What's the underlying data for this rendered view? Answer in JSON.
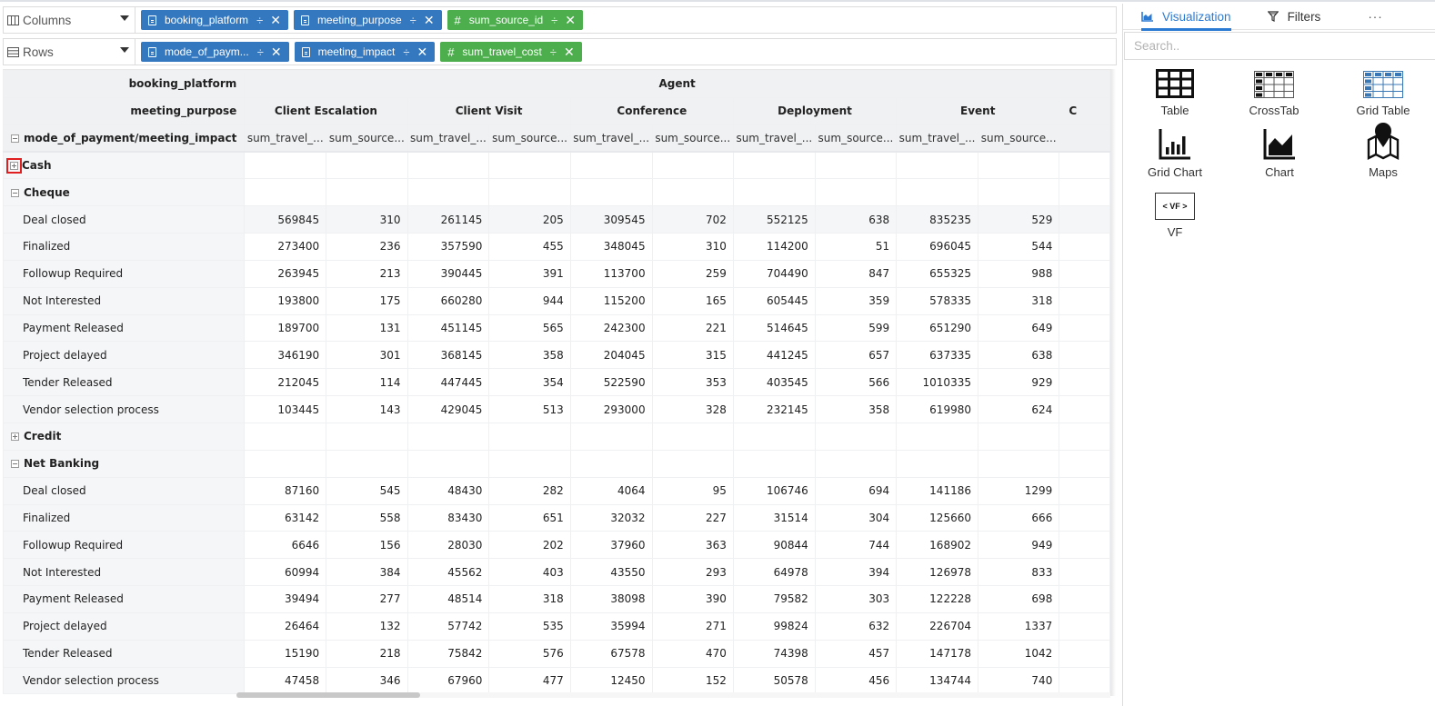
{
  "shelves": {
    "columns": {
      "label": "Columns",
      "pills": [
        {
          "label": "booking_platform",
          "type": "dimension",
          "color": "#3478c0"
        },
        {
          "label": "meeting_purpose",
          "type": "dimension",
          "color": "#3478c0"
        },
        {
          "label": "sum_source_id",
          "type": "measure",
          "color": "#4cae4c"
        }
      ]
    },
    "rows": {
      "label": "Rows",
      "pills": [
        {
          "label": "mode_of_paym...",
          "type": "dimension",
          "color": "#3478c0"
        },
        {
          "label": "meeting_impact",
          "type": "dimension",
          "color": "#3478c0"
        },
        {
          "label": "sum_travel_cost",
          "type": "measure",
          "color": "#4cae4c"
        }
      ]
    }
  },
  "pivot": {
    "col_field_1": "booking_platform",
    "col_field_2": "meeting_purpose",
    "row_field": "mode_of_payment/meeting_impact",
    "platform": "Agent",
    "purposes": [
      "Client Escalation",
      "Client Visit",
      "Conference",
      "Deployment",
      "Event"
    ],
    "measures": [
      "sum_travel_...",
      "sum_source..."
    ],
    "rows": [
      {
        "label": "Cash",
        "kind": "group",
        "collapsed": true,
        "highlighted": true,
        "values": []
      },
      {
        "label": "Cheque",
        "kind": "group",
        "collapsed": false,
        "values": []
      },
      {
        "label": "Deal closed",
        "kind": "sub",
        "values": [
          "569845",
          "310",
          "261145",
          "205",
          "309545",
          "702",
          "552125",
          "638",
          "835235",
          "529"
        ]
      },
      {
        "label": "Finalized",
        "kind": "sub",
        "values": [
          "273400",
          "236",
          "357590",
          "455",
          "348045",
          "310",
          "114200",
          "51",
          "696045",
          "544"
        ]
      },
      {
        "label": "Followup Required",
        "kind": "sub",
        "values": [
          "263945",
          "213",
          "390445",
          "391",
          "113700",
          "259",
          "704490",
          "847",
          "655325",
          "988"
        ]
      },
      {
        "label": "Not Interested",
        "kind": "sub",
        "values": [
          "193800",
          "175",
          "660280",
          "944",
          "115200",
          "165",
          "605445",
          "359",
          "578335",
          "318"
        ]
      },
      {
        "label": "Payment Released",
        "kind": "sub",
        "values": [
          "189700",
          "131",
          "451145",
          "565",
          "242300",
          "221",
          "514645",
          "599",
          "651290",
          "649"
        ]
      },
      {
        "label": "Project delayed",
        "kind": "sub",
        "values": [
          "346190",
          "301",
          "368145",
          "358",
          "204045",
          "315",
          "441245",
          "657",
          "637335",
          "638"
        ]
      },
      {
        "label": "Tender Released",
        "kind": "sub",
        "values": [
          "212045",
          "114",
          "447445",
          "354",
          "522590",
          "353",
          "403545",
          "566",
          "1010335",
          "929"
        ]
      },
      {
        "label": "Vendor selection process",
        "kind": "sub",
        "values": [
          "103445",
          "143",
          "429045",
          "513",
          "293000",
          "328",
          "232145",
          "358",
          "619980",
          "624"
        ]
      },
      {
        "label": "Credit",
        "kind": "group",
        "collapsed": true,
        "values": []
      },
      {
        "label": "Net Banking",
        "kind": "group",
        "collapsed": false,
        "values": []
      },
      {
        "label": "Deal closed",
        "kind": "sub",
        "values": [
          "87160",
          "545",
          "48430",
          "282",
          "4064",
          "95",
          "106746",
          "694",
          "141186",
          "1299"
        ]
      },
      {
        "label": "Finalized",
        "kind": "sub",
        "values": [
          "63142",
          "558",
          "83430",
          "651",
          "32032",
          "227",
          "31514",
          "304",
          "125660",
          "666"
        ]
      },
      {
        "label": "Followup Required",
        "kind": "sub",
        "values": [
          "6646",
          "156",
          "28030",
          "202",
          "37960",
          "363",
          "90844",
          "744",
          "168902",
          "949"
        ]
      },
      {
        "label": "Not Interested",
        "kind": "sub",
        "values": [
          "60994",
          "384",
          "45562",
          "403",
          "43550",
          "293",
          "64978",
          "394",
          "126978",
          "833"
        ]
      },
      {
        "label": "Payment Released",
        "kind": "sub",
        "values": [
          "39494",
          "277",
          "48514",
          "318",
          "38098",
          "390",
          "79582",
          "303",
          "122228",
          "698"
        ]
      },
      {
        "label": "Project delayed",
        "kind": "sub",
        "values": [
          "26464",
          "132",
          "57742",
          "535",
          "35994",
          "271",
          "99824",
          "632",
          "226704",
          "1337"
        ]
      },
      {
        "label": "Tender Released",
        "kind": "sub",
        "values": [
          "15190",
          "218",
          "75842",
          "576",
          "67578",
          "470",
          "74398",
          "457",
          "147178",
          "1042"
        ]
      },
      {
        "label": "Vendor selection process",
        "kind": "sub",
        "values": [
          "47458",
          "346",
          "67960",
          "477",
          "12450",
          "152",
          "50578",
          "456",
          "134744",
          "740"
        ]
      }
    ]
  },
  "panel": {
    "tabs": [
      {
        "label": "Visualization",
        "icon": "area-chart-icon",
        "active": true
      },
      {
        "label": "Filters",
        "icon": "filter-icon",
        "active": false
      },
      {
        "label": "···",
        "icon": "more-icon",
        "active": false
      }
    ],
    "search_placeholder": "Search..",
    "visualizations": [
      {
        "label": "Table",
        "icon": "table-icon"
      },
      {
        "label": "CrossTab",
        "icon": "crosstab-icon"
      },
      {
        "label": "Grid Table",
        "icon": "grid-table-icon"
      },
      {
        "label": "Grid Chart",
        "icon": "grid-chart-icon"
      },
      {
        "label": "Chart",
        "icon": "chart-icon"
      },
      {
        "label": "Maps",
        "icon": "maps-icon"
      },
      {
        "label": "VF",
        "icon": "vf-icon",
        "badge": "< VF >"
      }
    ]
  },
  "colors": {
    "accent": "#2a7ad3",
    "dimension_pill": "#3478c0",
    "measure_pill": "#4cae4c",
    "highlight": "#e02020"
  }
}
